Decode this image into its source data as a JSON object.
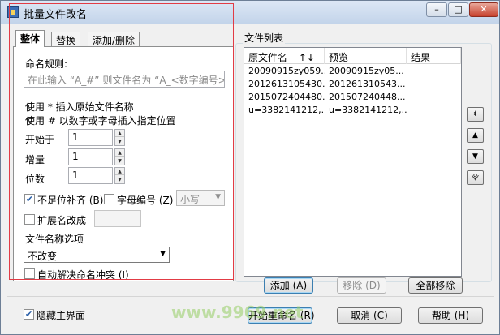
{
  "window": {
    "title": "批量文件改名",
    "controls": {
      "minimize": "–",
      "maximize": "□",
      "close": "✕"
    }
  },
  "tabs": [
    {
      "label": "整体",
      "active": true
    },
    {
      "label": "替换",
      "active": false
    },
    {
      "label": "添加/删除",
      "active": false
    }
  ],
  "rule": {
    "label": "命名规则:",
    "placeholder": "在此输入 “A_#” 则文件名为 “A_<数字编号>”"
  },
  "hints": [
    "使用 * 插入原始文件名称",
    "使用 # 以数字或字母插入指定位置"
  ],
  "numbering": {
    "start_label": "开始于",
    "start_value": "1",
    "step_label": "增量",
    "step_value": "1",
    "digits_label": "位数",
    "digits_value": "1"
  },
  "options": {
    "pad_label": "不足位补齐 (B)",
    "pad_checked": true,
    "alpha_label": "字母编号 (Z)",
    "alpha_checked": false,
    "case_value": "小写",
    "ext_label": "扩展名改成",
    "ext_checked": false,
    "ext_value": ""
  },
  "name_options": {
    "label": "文件名称选项",
    "selected": "不改变"
  },
  "auto_resolve": {
    "label": "自动解决命名冲突 (I)",
    "checked": false
  },
  "file_list": {
    "title": "文件列表",
    "columns": {
      "original": "原文件名",
      "sort": "↑↓",
      "preview": "预览",
      "result": "结果"
    },
    "rows": [
      {
        "original": "20090915zy059...",
        "preview": "20090915zy05...",
        "result": ""
      },
      {
        "original": "2012613105430...",
        "preview": "201261310543...",
        "result": ""
      },
      {
        "original": "2015072404480...",
        "preview": "201507240448...",
        "result": ""
      },
      {
        "original": "u=3382141212,...",
        "preview": "u=3382141212,...",
        "result": ""
      }
    ]
  },
  "side_buttons": {
    "top": "⯒",
    "up": "▲",
    "down": "▼",
    "bottom": "⯓"
  },
  "list_buttons": {
    "add": "添加 (A)",
    "remove": "移除 (D)",
    "remove_all": "全部移除"
  },
  "hide_main": {
    "label": "隐藏主界面",
    "checked": true
  },
  "buttons": {
    "start": "开始重命名 (R)",
    "cancel": "取消 (C)",
    "help": "帮助 (H)"
  },
  "watermark": "www.9969.net"
}
